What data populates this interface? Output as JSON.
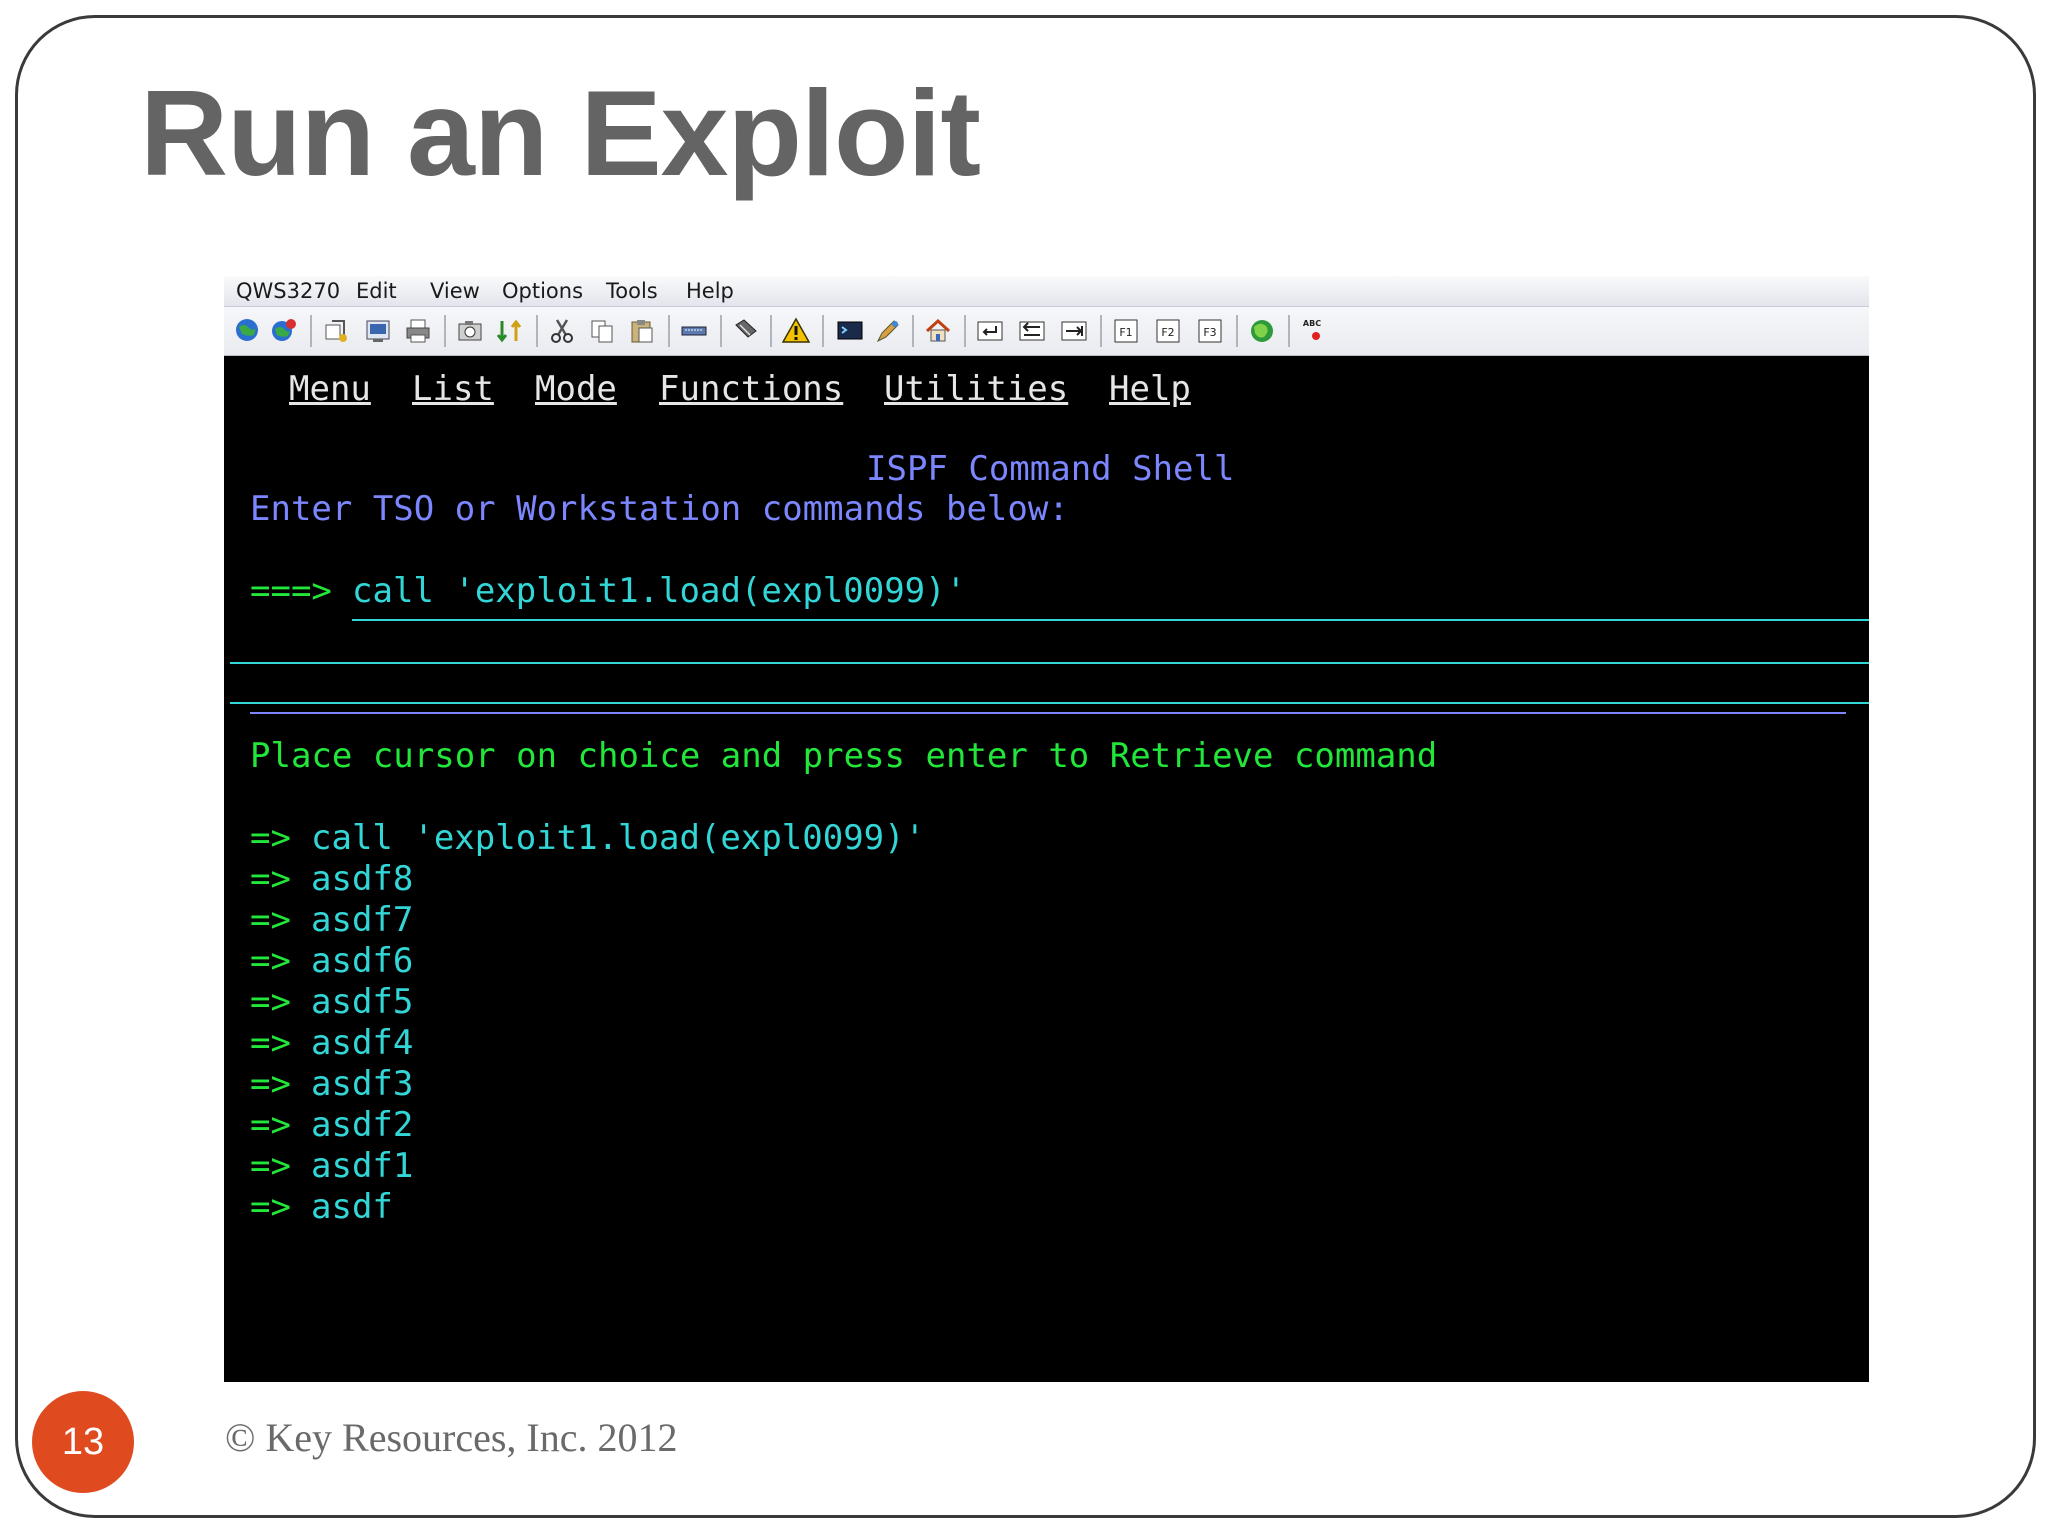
{
  "slide": {
    "title": "Run an Exploit",
    "footer": "© Key Resources, Inc. 2012",
    "page_number": "13"
  },
  "window": {
    "menu": [
      "QWS3270",
      "Edit",
      "View",
      "Options",
      "Tools",
      "Help"
    ]
  },
  "terminal": {
    "action_bar": [
      "Menu",
      "List",
      "Mode",
      "Functions",
      "Utilities",
      "Help"
    ],
    "panel_title": "ISPF Command Shell",
    "instruction": "Enter TSO or Workstation commands below:",
    "prompt": "===>",
    "command_value": "call 'exploit1.load(expl0099)'",
    "retrieve_hint": "Place cursor on choice and press enter to Retrieve command",
    "history_arrow": "=>",
    "history": [
      "call 'exploit1.load(expl0099)'",
      "asdf8",
      "asdf7",
      "asdf6",
      "asdf5",
      "asdf4",
      "asdf3",
      "asdf2",
      "asdf1",
      "asdf"
    ]
  },
  "colors": {
    "terminal_bg": "#000000",
    "ispf_blue": "#7b86ff",
    "turquoise": "#33d6d6",
    "green": "#22e63a",
    "badge": "#e04a1f",
    "title_gray": "#646464"
  },
  "toolbar_icons": [
    "connect-globe-icon",
    "disconnect-globe-icon",
    "new-session-icon",
    "save-screen-icon",
    "print-icon",
    "capture-icon",
    "transfer-icon",
    "cut-icon",
    "copy-icon",
    "paste-icon",
    "keyboard-icon",
    "macro-icon",
    "warning-icon",
    "display-icon",
    "pen-icon",
    "home-icon",
    "enter-icon",
    "tab-back-icon",
    "tab-forward-icon",
    "pf1-icon",
    "pf2-icon",
    "pf3-icon",
    "world-icon",
    "spell-check-icon"
  ]
}
